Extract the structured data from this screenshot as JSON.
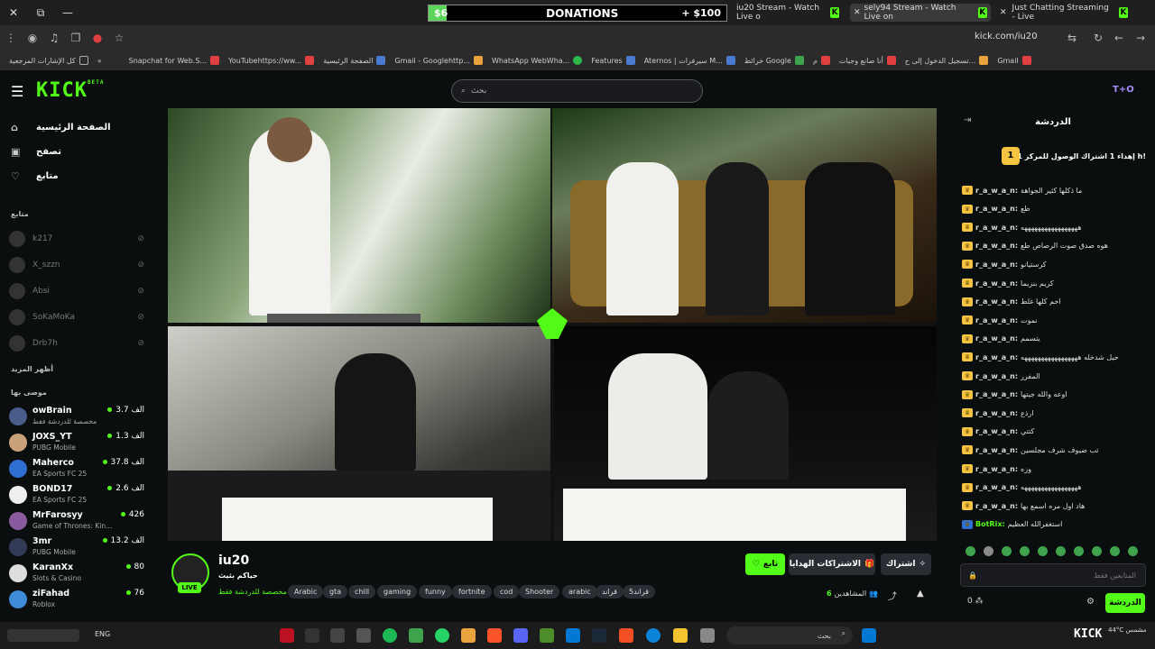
{
  "browser": {
    "donation": {
      "current": "$6",
      "label": "DONATIONS",
      "goal": "+ $100",
      "progress": 0.06
    },
    "tabs": [
      {
        "title": "iu20 Stream - Watch Live o",
        "active": false
      },
      {
        "title": "sely94 Stream - Watch Live on",
        "active": true
      },
      {
        "title": "Just Chatting Streaming - Live",
        "active": false
      }
    ],
    "url": "kick.com/iu20",
    "bookmarks": [
      "كل الإشارات المرجعية",
      "Snapchat for Web.S...",
      "YouTubehttps://ww...",
      "الصفحة الرئيسية",
      "Gmail - Googlehttp...",
      "WhatsApp WebWha...",
      "Features",
      "Aternos | سيرفرات M...",
      "خرائط Google",
      "م",
      "أنا صانع وجبات",
      "تسجيل الدخول إلى ح...",
      "Gmail"
    ]
  },
  "header": {
    "logo": "KICK",
    "logo_beta": "BETA",
    "search_placeholder": "بحث",
    "user_badge": "T+O"
  },
  "sidebar": {
    "nav": [
      {
        "label": "الصفحة الرئيسية",
        "icon": "home-icon"
      },
      {
        "label": "تصفح",
        "icon": "browse-icon"
      },
      {
        "label": "متابع",
        "icon": "heart-icon"
      }
    ],
    "following_title": "متابع",
    "following": [
      {
        "name": "k217"
      },
      {
        "name": "X_szzn"
      },
      {
        "name": "Absi"
      },
      {
        "name": "SoKaMoKa"
      },
      {
        "name": "Drb7h"
      }
    ],
    "show_more": "أظهر المزيد",
    "recommended_title": "موصى بها",
    "recommended": [
      {
        "name": "owBrain",
        "category": "مخصصة للدردشة فقط",
        "viewers": "3.7 الف",
        "color": "#4a5c8a"
      },
      {
        "name": "JOXS_YT",
        "category": "PUBG Mobile",
        "viewers": "1.3 الف",
        "color": "#c9a17a"
      },
      {
        "name": "Maherco",
        "category": "EA Sports FC 25",
        "viewers": "37.8 الف",
        "color": "#2f6fd1"
      },
      {
        "name": "BOND17",
        "category": "EA Sports FC 25",
        "viewers": "2.6 الف",
        "color": "#eeeeee"
      },
      {
        "name": "MrFarosyy",
        "category": "Game of Thrones: Kin...",
        "viewers": "426",
        "color": "#8a5a9e"
      },
      {
        "name": "3mr",
        "category": "PUBG Mobile",
        "viewers": "13.2 الف",
        "color": "#333a55"
      },
      {
        "name": "KaranXx",
        "category": "Slots & Casino",
        "viewers": "80",
        "color": "#dddddd"
      },
      {
        "name": "ziFahad",
        "category": "Roblox",
        "viewers": "76",
        "color": "#3d8bd9"
      }
    ]
  },
  "stream": {
    "channel": "iu20",
    "title": "حياكم بثيث",
    "category": "مخصصة للدردشة فقط",
    "live": "LIVE",
    "tags": [
      "Arabic",
      "gta",
      "chill",
      "gaming",
      "funny",
      "fortnite",
      "cod",
      "Shooter",
      "arabic",
      "قراند",
      "قراند5"
    ],
    "follow_label": "تابع",
    "gift_label": "الاشتراكات الهدايا",
    "subscribe_label": "اشتراك",
    "viewers_count": "6",
    "viewers_label": "المشاهدين"
  },
  "chat": {
    "title": "الدردشة",
    "pinned_rank": "1",
    "pinned_text": "إهداء 1 اشتراك الوصول للمركز 1 h!",
    "messages": [
      {
        "user": "r_a_w_a_n:",
        "text": "ما ذكلها كثير الجواهة"
      },
      {
        "user": "r_a_w_a_n:",
        "text": "طع"
      },
      {
        "user": "r_a_w_a_n:",
        "text": "هههههههههههههههههه"
      },
      {
        "user": "r_a_w_a_n:",
        "text": "هوه صدق صوت الرصاص طع"
      },
      {
        "user": "r_a_w_a_n:",
        "text": "كرستيانو"
      },
      {
        "user": "r_a_w_a_n:",
        "text": "كريم بنزيما"
      },
      {
        "user": "r_a_w_a_n:",
        "text": "احم كلها غلط"
      },
      {
        "user": "r_a_w_a_n:",
        "text": "نموت"
      },
      {
        "user": "r_a_w_a_n:",
        "text": "يتسمم"
      },
      {
        "user": "r_a_w_a_n:",
        "text": "حيل شدخله هههههههههههههههههه"
      },
      {
        "user": "r_a_w_a_n:",
        "text": "المفرر"
      },
      {
        "user": "r_a_w_a_n:",
        "text": "اوعه والله جيتها"
      },
      {
        "user": "r_a_w_a_n:",
        "text": "ارذع"
      },
      {
        "user": "r_a_w_a_n:",
        "text": "كتتي"
      },
      {
        "user": "r_a_w_a_n:",
        "text": "تب ضيوف شرف مجلسين"
      },
      {
        "user": "r_a_w_a_n:",
        "text": "وزه"
      },
      {
        "user": "r_a_w_a_n:",
        "text": "هههههههههههههههههه"
      },
      {
        "user": "r_a_w_a_n:",
        "text": "هاد اول مره اسمع بها"
      },
      {
        "user": "BotRix:",
        "text": "استغفرالله العظيم"
      }
    ],
    "input_placeholder": "المتابعين فقط",
    "send_label": "الدردشة",
    "points": "0"
  },
  "taskbar": {
    "lang": "ENG",
    "search_placeholder": "بحث",
    "weather": "44°C مشمس"
  },
  "colors": {
    "accent": "#53fc18",
    "background": "#0b0e0f"
  }
}
